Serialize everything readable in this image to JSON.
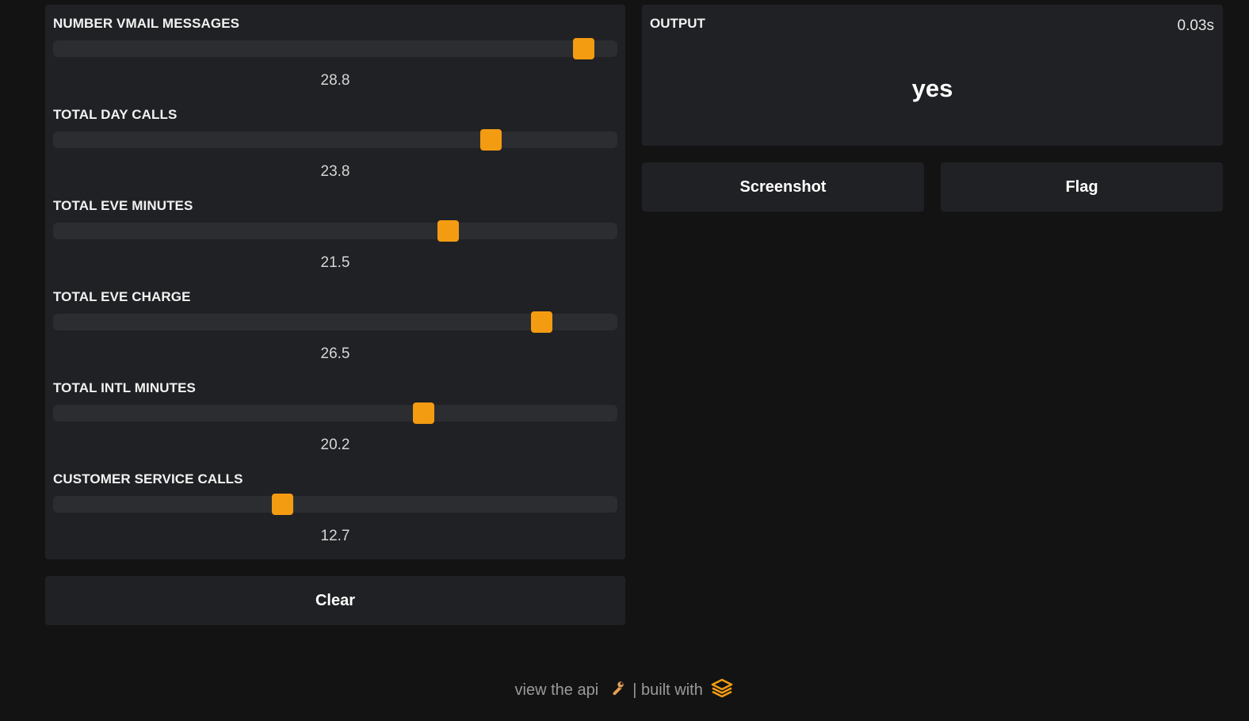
{
  "sliders": [
    {
      "label": "NUMBER VMAIL MESSAGES",
      "value": "28.8",
      "fraction": 0.94
    },
    {
      "label": "TOTAL DAY CALLS",
      "value": "23.8",
      "fraction": 0.775
    },
    {
      "label": "TOTAL EVE MINUTES",
      "value": "21.5",
      "fraction": 0.699
    },
    {
      "label": "TOTAL EVE CHARGE",
      "value": "26.5",
      "fraction": 0.865
    },
    {
      "label": "TOTAL INTL MINUTES",
      "value": "20.2",
      "fraction": 0.656
    },
    {
      "label": "CUSTOMER SERVICE CALLS",
      "value": "12.7",
      "fraction": 0.406
    }
  ],
  "buttons": {
    "clear": "Clear",
    "screenshot": "Screenshot",
    "flag": "Flag"
  },
  "output": {
    "label": "OUTPUT",
    "time": "0.03s",
    "value": "yes"
  },
  "footer": {
    "api_link": "view the api",
    "built_with": "| built with"
  },
  "colors": {
    "accent": "#f39c12",
    "panel": "#202124",
    "background": "#131313",
    "track": "#2c2d30"
  },
  "icons": {
    "api": "wrench-icon",
    "brand": "stacked-layers-logo-icon"
  }
}
